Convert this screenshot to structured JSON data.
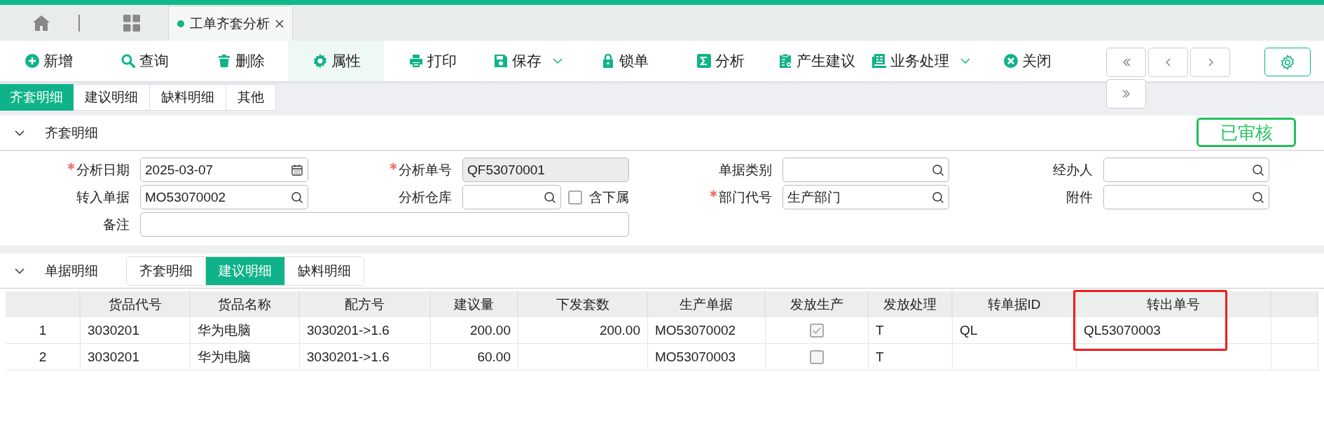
{
  "window_tabs": [
    {
      "label": "工单齐套分析",
      "selected": true
    }
  ],
  "toolbar": {
    "buttons": [
      {
        "label": "新增",
        "selected": false,
        "has_menu": false
      },
      {
        "label": "查询",
        "selected": false,
        "has_menu": false
      },
      {
        "label": "删除",
        "selected": false,
        "has_menu": false
      },
      {
        "label": "属性",
        "selected": true,
        "has_menu": false
      },
      {
        "label": "打印",
        "selected": false,
        "has_menu": false
      },
      {
        "label": "保存",
        "selected": false,
        "has_menu": true
      },
      {
        "label": "锁单",
        "selected": false,
        "has_menu": false
      },
      {
        "label": "分析",
        "selected": false,
        "has_menu": false
      },
      {
        "label": "产生建议",
        "selected": false,
        "has_menu": false
      },
      {
        "label": "业务处理",
        "selected": false,
        "has_menu": true
      },
      {
        "label": "关闭",
        "selected": false,
        "has_menu": false
      }
    ]
  },
  "page_tabs": [
    {
      "label": "齐套明细",
      "selected": true
    },
    {
      "label": "建议明细",
      "selected": false
    },
    {
      "label": "缺料明细",
      "selected": false
    },
    {
      "label": "其他",
      "selected": false
    }
  ],
  "header_section": {
    "title": "齐套明细",
    "expanded": true,
    "status_stamp": "已审核",
    "fields": [
      {
        "label": "分析日期",
        "required": true,
        "kind": "date",
        "value": "2025-03-07"
      },
      {
        "label": "分析单号",
        "required": true,
        "kind": "readonly",
        "value": "QF53070001"
      },
      {
        "label": "单据类别",
        "required": false,
        "kind": "lookup"
      },
      {
        "label": "经办人",
        "required": false,
        "kind": "lookup"
      },
      {
        "label": "转入单据",
        "required": false,
        "kind": "lookup",
        "value": "MO53070002"
      },
      {
        "label": "分析仓库",
        "required": false,
        "kind": "lookup",
        "checkbox": {
          "label": "含下属",
          "checked": false
        }
      },
      {
        "label": "部门代号",
        "required": true,
        "kind": "lookup",
        "value": "生产部门"
      },
      {
        "label": "附件",
        "required": false,
        "kind": "lookup"
      },
      {
        "label": "备注",
        "required": false,
        "kind": "text"
      }
    ]
  },
  "detail_section": {
    "title": "单据明细",
    "expanded": true,
    "tabs": [
      {
        "label": "齐套明细",
        "selected": false
      },
      {
        "label": "建议明细",
        "selected": true
      },
      {
        "label": "缺料明细",
        "selected": false
      }
    ],
    "table": {
      "columns": [
        {
          "label": "货品代号",
          "highlighted": false
        },
        {
          "label": "货品名称",
          "highlighted": false
        },
        {
          "label": "配方号",
          "highlighted": false
        },
        {
          "label": "建议量",
          "highlighted": false
        },
        {
          "label": "下发套数",
          "highlighted": false
        },
        {
          "label": "生产单据",
          "highlighted": false
        },
        {
          "label": "发放生产",
          "highlighted": false
        },
        {
          "label": "发放处理",
          "highlighted": false
        },
        {
          "label": "转单据ID",
          "highlighted": false
        },
        {
          "label": "转出单号",
          "highlighted": true
        }
      ],
      "rows": [
        {
          "no": "1",
          "item_code": "3030201",
          "item_name": "华为电脑",
          "formula_no": "3030201->1.6",
          "suggested_qty": "200.00",
          "issued_sets": "200.00",
          "production_doc": "MO53070002",
          "release_production": true,
          "release_handling": "T",
          "transfer_doc_id": "QL",
          "transfer_out_no": "QL53070003"
        },
        {
          "no": "2",
          "item_code": "3030201",
          "item_name": "华为电脑",
          "formula_no": "3030201->1.6",
          "suggested_qty": "60.00",
          "production_doc": "MO53070003",
          "release_production": false,
          "release_handling": "T"
        }
      ]
    }
  }
}
